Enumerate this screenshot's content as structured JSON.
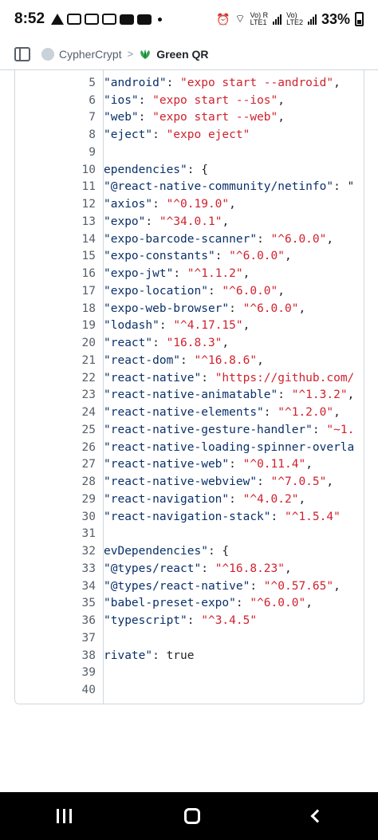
{
  "status_bar": {
    "time": "8:52",
    "net1": "Vo) R\nLTE1",
    "net2": "Vo)\nLTE2",
    "battery": "33%"
  },
  "header": {
    "owner": "CypherCrypt",
    "separator": ">",
    "repo": "Green QR"
  },
  "code": {
    "lines": [
      {
        "n": "5",
        "parts": [
          {
            "t": "\"android\"",
            "c": "key"
          },
          {
            "t": ": ",
            "c": "plain"
          },
          {
            "t": "\"expo start --android\"",
            "c": "str"
          },
          {
            "t": ",",
            "c": "plain"
          }
        ]
      },
      {
        "n": "6",
        "parts": [
          {
            "t": "\"ios\"",
            "c": "key"
          },
          {
            "t": ": ",
            "c": "plain"
          },
          {
            "t": "\"expo start --ios\"",
            "c": "str"
          },
          {
            "t": ",",
            "c": "plain"
          }
        ]
      },
      {
        "n": "7",
        "parts": [
          {
            "t": "\"web\"",
            "c": "key"
          },
          {
            "t": ": ",
            "c": "plain"
          },
          {
            "t": "\"expo start --web\"",
            "c": "str"
          },
          {
            "t": ",",
            "c": "plain"
          }
        ]
      },
      {
        "n": "8",
        "parts": [
          {
            "t": "\"eject\"",
            "c": "key"
          },
          {
            "t": ": ",
            "c": "plain"
          },
          {
            "t": "\"expo eject\"",
            "c": "str"
          }
        ]
      },
      {
        "n": "9",
        "parts": []
      },
      {
        "n": "10",
        "parts": [
          {
            "t": "ependencies\"",
            "c": "key"
          },
          {
            "t": ": {",
            "c": "plain"
          }
        ]
      },
      {
        "n": "11",
        "parts": [
          {
            "t": "\"@react-native-community/netinfo\"",
            "c": "key"
          },
          {
            "t": ": \"",
            "c": "plain"
          }
        ]
      },
      {
        "n": "12",
        "parts": [
          {
            "t": "\"axios\"",
            "c": "key"
          },
          {
            "t": ": ",
            "c": "plain"
          },
          {
            "t": "\"^0.19.0\"",
            "c": "str"
          },
          {
            "t": ",",
            "c": "plain"
          }
        ]
      },
      {
        "n": "13",
        "parts": [
          {
            "t": "\"expo\"",
            "c": "key"
          },
          {
            "t": ": ",
            "c": "plain"
          },
          {
            "t": "\"^34.0.1\"",
            "c": "str"
          },
          {
            "t": ",",
            "c": "plain"
          }
        ]
      },
      {
        "n": "14",
        "parts": [
          {
            "t": "\"expo-barcode-scanner\"",
            "c": "key"
          },
          {
            "t": ": ",
            "c": "plain"
          },
          {
            "t": "\"^6.0.0\"",
            "c": "str"
          },
          {
            "t": ",",
            "c": "plain"
          }
        ]
      },
      {
        "n": "15",
        "parts": [
          {
            "t": "\"expo-constants\"",
            "c": "key"
          },
          {
            "t": ": ",
            "c": "plain"
          },
          {
            "t": "\"^6.0.0\"",
            "c": "str"
          },
          {
            "t": ",",
            "c": "plain"
          }
        ]
      },
      {
        "n": "16",
        "parts": [
          {
            "t": "\"expo-jwt\"",
            "c": "key"
          },
          {
            "t": ": ",
            "c": "plain"
          },
          {
            "t": "\"^1.1.2\"",
            "c": "str"
          },
          {
            "t": ",",
            "c": "plain"
          }
        ]
      },
      {
        "n": "17",
        "parts": [
          {
            "t": "\"expo-location\"",
            "c": "key"
          },
          {
            "t": ": ",
            "c": "plain"
          },
          {
            "t": "\"^6.0.0\"",
            "c": "str"
          },
          {
            "t": ",",
            "c": "plain"
          }
        ]
      },
      {
        "n": "18",
        "parts": [
          {
            "t": "\"expo-web-browser\"",
            "c": "key"
          },
          {
            "t": ": ",
            "c": "plain"
          },
          {
            "t": "\"^6.0.0\"",
            "c": "str"
          },
          {
            "t": ",",
            "c": "plain"
          }
        ]
      },
      {
        "n": "19",
        "parts": [
          {
            "t": "\"lodash\"",
            "c": "key"
          },
          {
            "t": ": ",
            "c": "plain"
          },
          {
            "t": "\"^4.17.15\"",
            "c": "str"
          },
          {
            "t": ",",
            "c": "plain"
          }
        ]
      },
      {
        "n": "20",
        "parts": [
          {
            "t": "\"react\"",
            "c": "key"
          },
          {
            "t": ": ",
            "c": "plain"
          },
          {
            "t": "\"16.8.3\"",
            "c": "str"
          },
          {
            "t": ",",
            "c": "plain"
          }
        ]
      },
      {
        "n": "21",
        "parts": [
          {
            "t": "\"react-dom\"",
            "c": "key"
          },
          {
            "t": ": ",
            "c": "plain"
          },
          {
            "t": "\"^16.8.6\"",
            "c": "str"
          },
          {
            "t": ",",
            "c": "plain"
          }
        ]
      },
      {
        "n": "22",
        "parts": [
          {
            "t": "\"react-native\"",
            "c": "key"
          },
          {
            "t": ": ",
            "c": "plain"
          },
          {
            "t": "\"https://github.com/",
            "c": "str"
          }
        ]
      },
      {
        "n": "23",
        "parts": [
          {
            "t": "\"react-native-animatable\"",
            "c": "key"
          },
          {
            "t": ": ",
            "c": "plain"
          },
          {
            "t": "\"^1.3.2\"",
            "c": "str"
          },
          {
            "t": ",",
            "c": "plain"
          }
        ]
      },
      {
        "n": "24",
        "parts": [
          {
            "t": "\"react-native-elements\"",
            "c": "key"
          },
          {
            "t": ": ",
            "c": "plain"
          },
          {
            "t": "\"^1.2.0\"",
            "c": "str"
          },
          {
            "t": ",",
            "c": "plain"
          }
        ]
      },
      {
        "n": "25",
        "parts": [
          {
            "t": "\"react-native-gesture-handler\"",
            "c": "key"
          },
          {
            "t": ": ",
            "c": "plain"
          },
          {
            "t": "\"~1.",
            "c": "str"
          }
        ]
      },
      {
        "n": "26",
        "parts": [
          {
            "t": "\"react-native-loading-spinner-overla",
            "c": "key"
          }
        ]
      },
      {
        "n": "27",
        "parts": [
          {
            "t": "\"react-native-web\"",
            "c": "key"
          },
          {
            "t": ": ",
            "c": "plain"
          },
          {
            "t": "\"^0.11.4\"",
            "c": "str"
          },
          {
            "t": ",",
            "c": "plain"
          }
        ]
      },
      {
        "n": "28",
        "parts": [
          {
            "t": "\"react-native-webview\"",
            "c": "key"
          },
          {
            "t": ": ",
            "c": "plain"
          },
          {
            "t": "\"^7.0.5\"",
            "c": "str"
          },
          {
            "t": ",",
            "c": "plain"
          }
        ]
      },
      {
        "n": "29",
        "parts": [
          {
            "t": "\"react-navigation\"",
            "c": "key"
          },
          {
            "t": ": ",
            "c": "plain"
          },
          {
            "t": "\"^4.0.2\"",
            "c": "str"
          },
          {
            "t": ",",
            "c": "plain"
          }
        ]
      },
      {
        "n": "30",
        "parts": [
          {
            "t": "\"react-navigation-stack\"",
            "c": "key"
          },
          {
            "t": ": ",
            "c": "plain"
          },
          {
            "t": "\"^1.5.4\"",
            "c": "str"
          }
        ]
      },
      {
        "n": "31",
        "parts": []
      },
      {
        "n": "32",
        "parts": [
          {
            "t": "evDependencies\"",
            "c": "key"
          },
          {
            "t": ": {",
            "c": "plain"
          }
        ]
      },
      {
        "n": "33",
        "parts": [
          {
            "t": "\"@types/react\"",
            "c": "key"
          },
          {
            "t": ": ",
            "c": "plain"
          },
          {
            "t": "\"^16.8.23\"",
            "c": "str"
          },
          {
            "t": ",",
            "c": "plain"
          }
        ]
      },
      {
        "n": "34",
        "parts": [
          {
            "t": "\"@types/react-native\"",
            "c": "key"
          },
          {
            "t": ": ",
            "c": "plain"
          },
          {
            "t": "\"^0.57.65\"",
            "c": "str"
          },
          {
            "t": ",",
            "c": "plain"
          }
        ]
      },
      {
        "n": "35",
        "parts": [
          {
            "t": "\"babel-preset-expo\"",
            "c": "key"
          },
          {
            "t": ": ",
            "c": "plain"
          },
          {
            "t": "\"^6.0.0\"",
            "c": "str"
          },
          {
            "t": ",",
            "c": "plain"
          }
        ]
      },
      {
        "n": "36",
        "parts": [
          {
            "t": "\"typescript\"",
            "c": "key"
          },
          {
            "t": ": ",
            "c": "plain"
          },
          {
            "t": "\"^3.4.5\"",
            "c": "str"
          }
        ]
      },
      {
        "n": "37",
        "parts": []
      },
      {
        "n": "38",
        "parts": [
          {
            "t": "rivate\"",
            "c": "key"
          },
          {
            "t": ": true",
            "c": "plain"
          }
        ]
      },
      {
        "n": "39",
        "parts": []
      },
      {
        "n": "40",
        "parts": []
      }
    ]
  },
  "icons": {
    "sidebar": "sidebar-toggle-icon",
    "repo": "leaf-icon",
    "recents": "recents-icon",
    "home": "home-icon",
    "back": "back-icon"
  },
  "colors": {
    "string": "#0a3069",
    "red": "#cf222e",
    "border": "#d0d7de",
    "line_number": "#57606a"
  }
}
